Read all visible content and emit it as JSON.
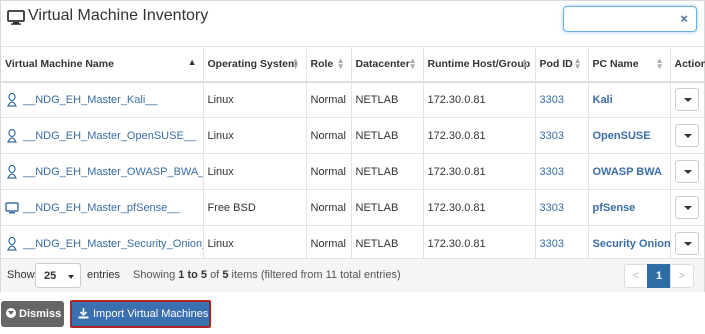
{
  "header": {
    "title": "Virtual Machine Inventory",
    "icon": "monitor-icon"
  },
  "search": {
    "value": "",
    "clear_label": "×"
  },
  "table": {
    "columns": [
      "Virtual Machine Name",
      "Operating System",
      "Role",
      "Datacenter",
      "Runtime Host/Group",
      "Pod ID",
      "PC Name",
      "Action"
    ],
    "rows": [
      {
        "icon": "linux-icon",
        "name": "__NDG_EH_Master_Kali__",
        "os": "Linux",
        "role": "Normal",
        "datacenter": "NETLAB",
        "host": "172.30.0.81",
        "pod_id": "3303",
        "pc_name": "Kali"
      },
      {
        "icon": "linux-icon",
        "name": "__NDG_EH_Master_OpenSUSE__",
        "os": "Linux",
        "role": "Normal",
        "datacenter": "NETLAB",
        "host": "172.30.0.81",
        "pod_id": "3303",
        "pc_name": "OpenSUSE"
      },
      {
        "icon": "linux-icon",
        "name": "__NDG_EH_Master_OWASP_BWA__",
        "os": "Linux",
        "role": "Normal",
        "datacenter": "NETLAB",
        "host": "172.30.0.81",
        "pod_id": "3303",
        "pc_name": "OWASP BWA"
      },
      {
        "icon": "monitor-icon",
        "name": "__NDG_EH_Master_pfSense__",
        "os": "Free BSD",
        "role": "Normal",
        "datacenter": "NETLAB",
        "host": "172.30.0.81",
        "pod_id": "3303",
        "pc_name": "pfSense"
      },
      {
        "icon": "linux-icon",
        "name": "__NDG_EH_Master_Security_Onion__",
        "os": "Linux",
        "role": "Normal",
        "datacenter": "NETLAB",
        "host": "172.30.0.81",
        "pod_id": "3303",
        "pc_name": "Security Onion"
      }
    ]
  },
  "footer": {
    "show_label": "Show",
    "page_size": "25",
    "entries_label": "entries",
    "info_prefix": "Showing",
    "info_range": "1 to 5",
    "info_of": "of",
    "info_total": "5",
    "info_suffix": "items (filtered from 11 total entries)",
    "pager": {
      "prev": "<",
      "current": "1",
      "next": ">"
    }
  },
  "buttons": {
    "dismiss": "Dismiss",
    "import": "Import Virtual Machines"
  },
  "colors": {
    "link": "#3a6ea5",
    "primary": "#3a6fb0",
    "highlight_border": "#b22222",
    "dismiss_bg": "#666666"
  }
}
